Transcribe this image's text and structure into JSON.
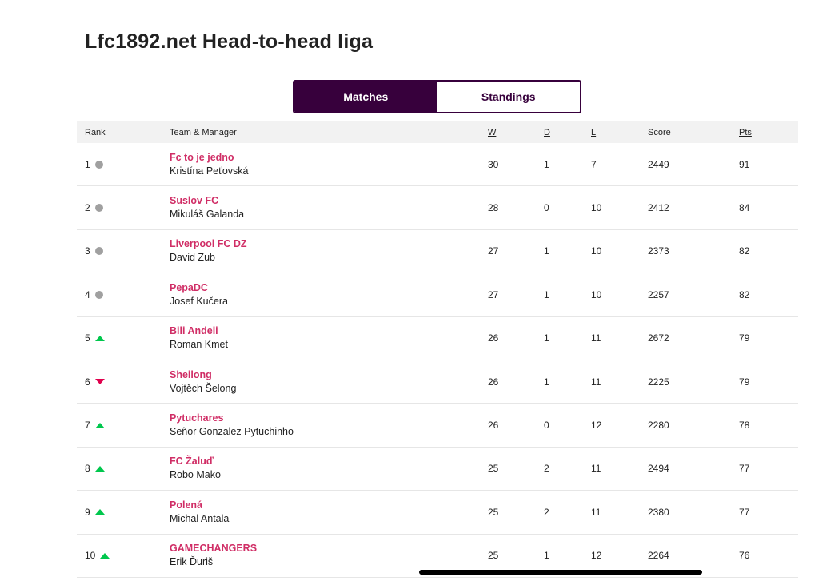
{
  "league": {
    "title": "Lfc1892.net Head-to-head liga"
  },
  "tabs": {
    "matches": "Matches",
    "standings": "Standings"
  },
  "columns": {
    "rank": "Rank",
    "team": "Team & Manager",
    "w": "W",
    "d": "D",
    "l": "L",
    "score": "Score",
    "pts": "Pts"
  },
  "colors": {
    "brand": "#37003c",
    "team_link": "#d02e66",
    "movement_same": "#a0a0a0",
    "movement_up": "#00c74d",
    "movement_down": "#e0004d"
  },
  "rows": [
    {
      "rank": "1",
      "movement": "same",
      "team": "Fc to je jedno",
      "manager": "Kristína Peťovská",
      "w": "30",
      "d": "1",
      "l": "7",
      "score": "2449",
      "pts": "91"
    },
    {
      "rank": "2",
      "movement": "same",
      "team": "Suslov FC",
      "manager": "Mikuláš Galanda",
      "w": "28",
      "d": "0",
      "l": "10",
      "score": "2412",
      "pts": "84"
    },
    {
      "rank": "3",
      "movement": "same",
      "team": "Liverpool FC DZ",
      "manager": "David Zub",
      "w": "27",
      "d": "1",
      "l": "10",
      "score": "2373",
      "pts": "82"
    },
    {
      "rank": "4",
      "movement": "same",
      "team": "PepaDC",
      "manager": "Josef Kučera",
      "w": "27",
      "d": "1",
      "l": "10",
      "score": "2257",
      "pts": "82"
    },
    {
      "rank": "5",
      "movement": "up",
      "team": "Bili Andeli",
      "manager": "Roman Kmet",
      "w": "26",
      "d": "1",
      "l": "11",
      "score": "2672",
      "pts": "79"
    },
    {
      "rank": "6",
      "movement": "down",
      "team": "Sheilong",
      "manager": "Vojtěch Šelong",
      "w": "26",
      "d": "1",
      "l": "11",
      "score": "2225",
      "pts": "79"
    },
    {
      "rank": "7",
      "movement": "up",
      "team": "Pytuchares",
      "manager": "Señor Gonzalez Pytuchinho",
      "w": "26",
      "d": "0",
      "l": "12",
      "score": "2280",
      "pts": "78"
    },
    {
      "rank": "8",
      "movement": "up",
      "team": "FC Žaluď",
      "manager": "Robo Mako",
      "w": "25",
      "d": "2",
      "l": "11",
      "score": "2494",
      "pts": "77"
    },
    {
      "rank": "9",
      "movement": "up",
      "team": "Polená",
      "manager": "Michal Antala",
      "w": "25",
      "d": "2",
      "l": "11",
      "score": "2380",
      "pts": "77"
    },
    {
      "rank": "10",
      "movement": "up",
      "team": "GAMECHANGERS",
      "manager": "Erik Ďuriš",
      "w": "25",
      "d": "1",
      "l": "12",
      "score": "2264",
      "pts": "76"
    }
  ]
}
